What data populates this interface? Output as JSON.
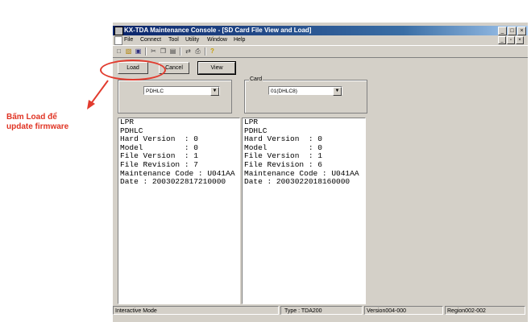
{
  "window": {
    "title": "KX-TDA Maintenance Console - [SD Card File View and Load]",
    "controls": [
      "_",
      "□",
      "×"
    ],
    "mdi_controls": [
      "_",
      "▫",
      "×"
    ]
  },
  "menu": [
    "File",
    "Connect",
    "Tool",
    "Utility",
    "Window",
    "Help"
  ],
  "toolbar_icons": [
    "new-icon",
    "open-icon",
    "save-icon",
    "cut-icon",
    "copy-icon",
    "paste-icon",
    "connect-icon",
    "print-icon",
    "help-icon"
  ],
  "buttons": {
    "load": "Load",
    "cancel": "Cancel",
    "view": "View"
  },
  "left_group": {
    "label": "",
    "combo_value": "PDHLC"
  },
  "card_group": {
    "label": "Card",
    "combo_value": "01(DHLC8)"
  },
  "left_panel": [
    "LPR",
    "PDHLC",
    "Hard Version  : 0",
    "Model         : 0",
    "File Version  : 1",
    "File Revision : 7",
    "Maintenance Code : U041AA",
    "Date : 2003022817210000"
  ],
  "right_panel": [
    "LPR",
    "PDHLC",
    "Hard Version  : 0",
    "Model         : 0",
    "File Version  : 1",
    "File Revision : 6",
    "Maintenance Code : U041AA",
    "Date : 2003022018160000"
  ],
  "status": {
    "mode": "Interactive Mode",
    "type": "Type : TDA200",
    "version": "Version004-000",
    "region": "Region002-002"
  },
  "annotation": {
    "line1": "Bấm Load để",
    "line2": "update firmware",
    "color": "#e03424"
  }
}
